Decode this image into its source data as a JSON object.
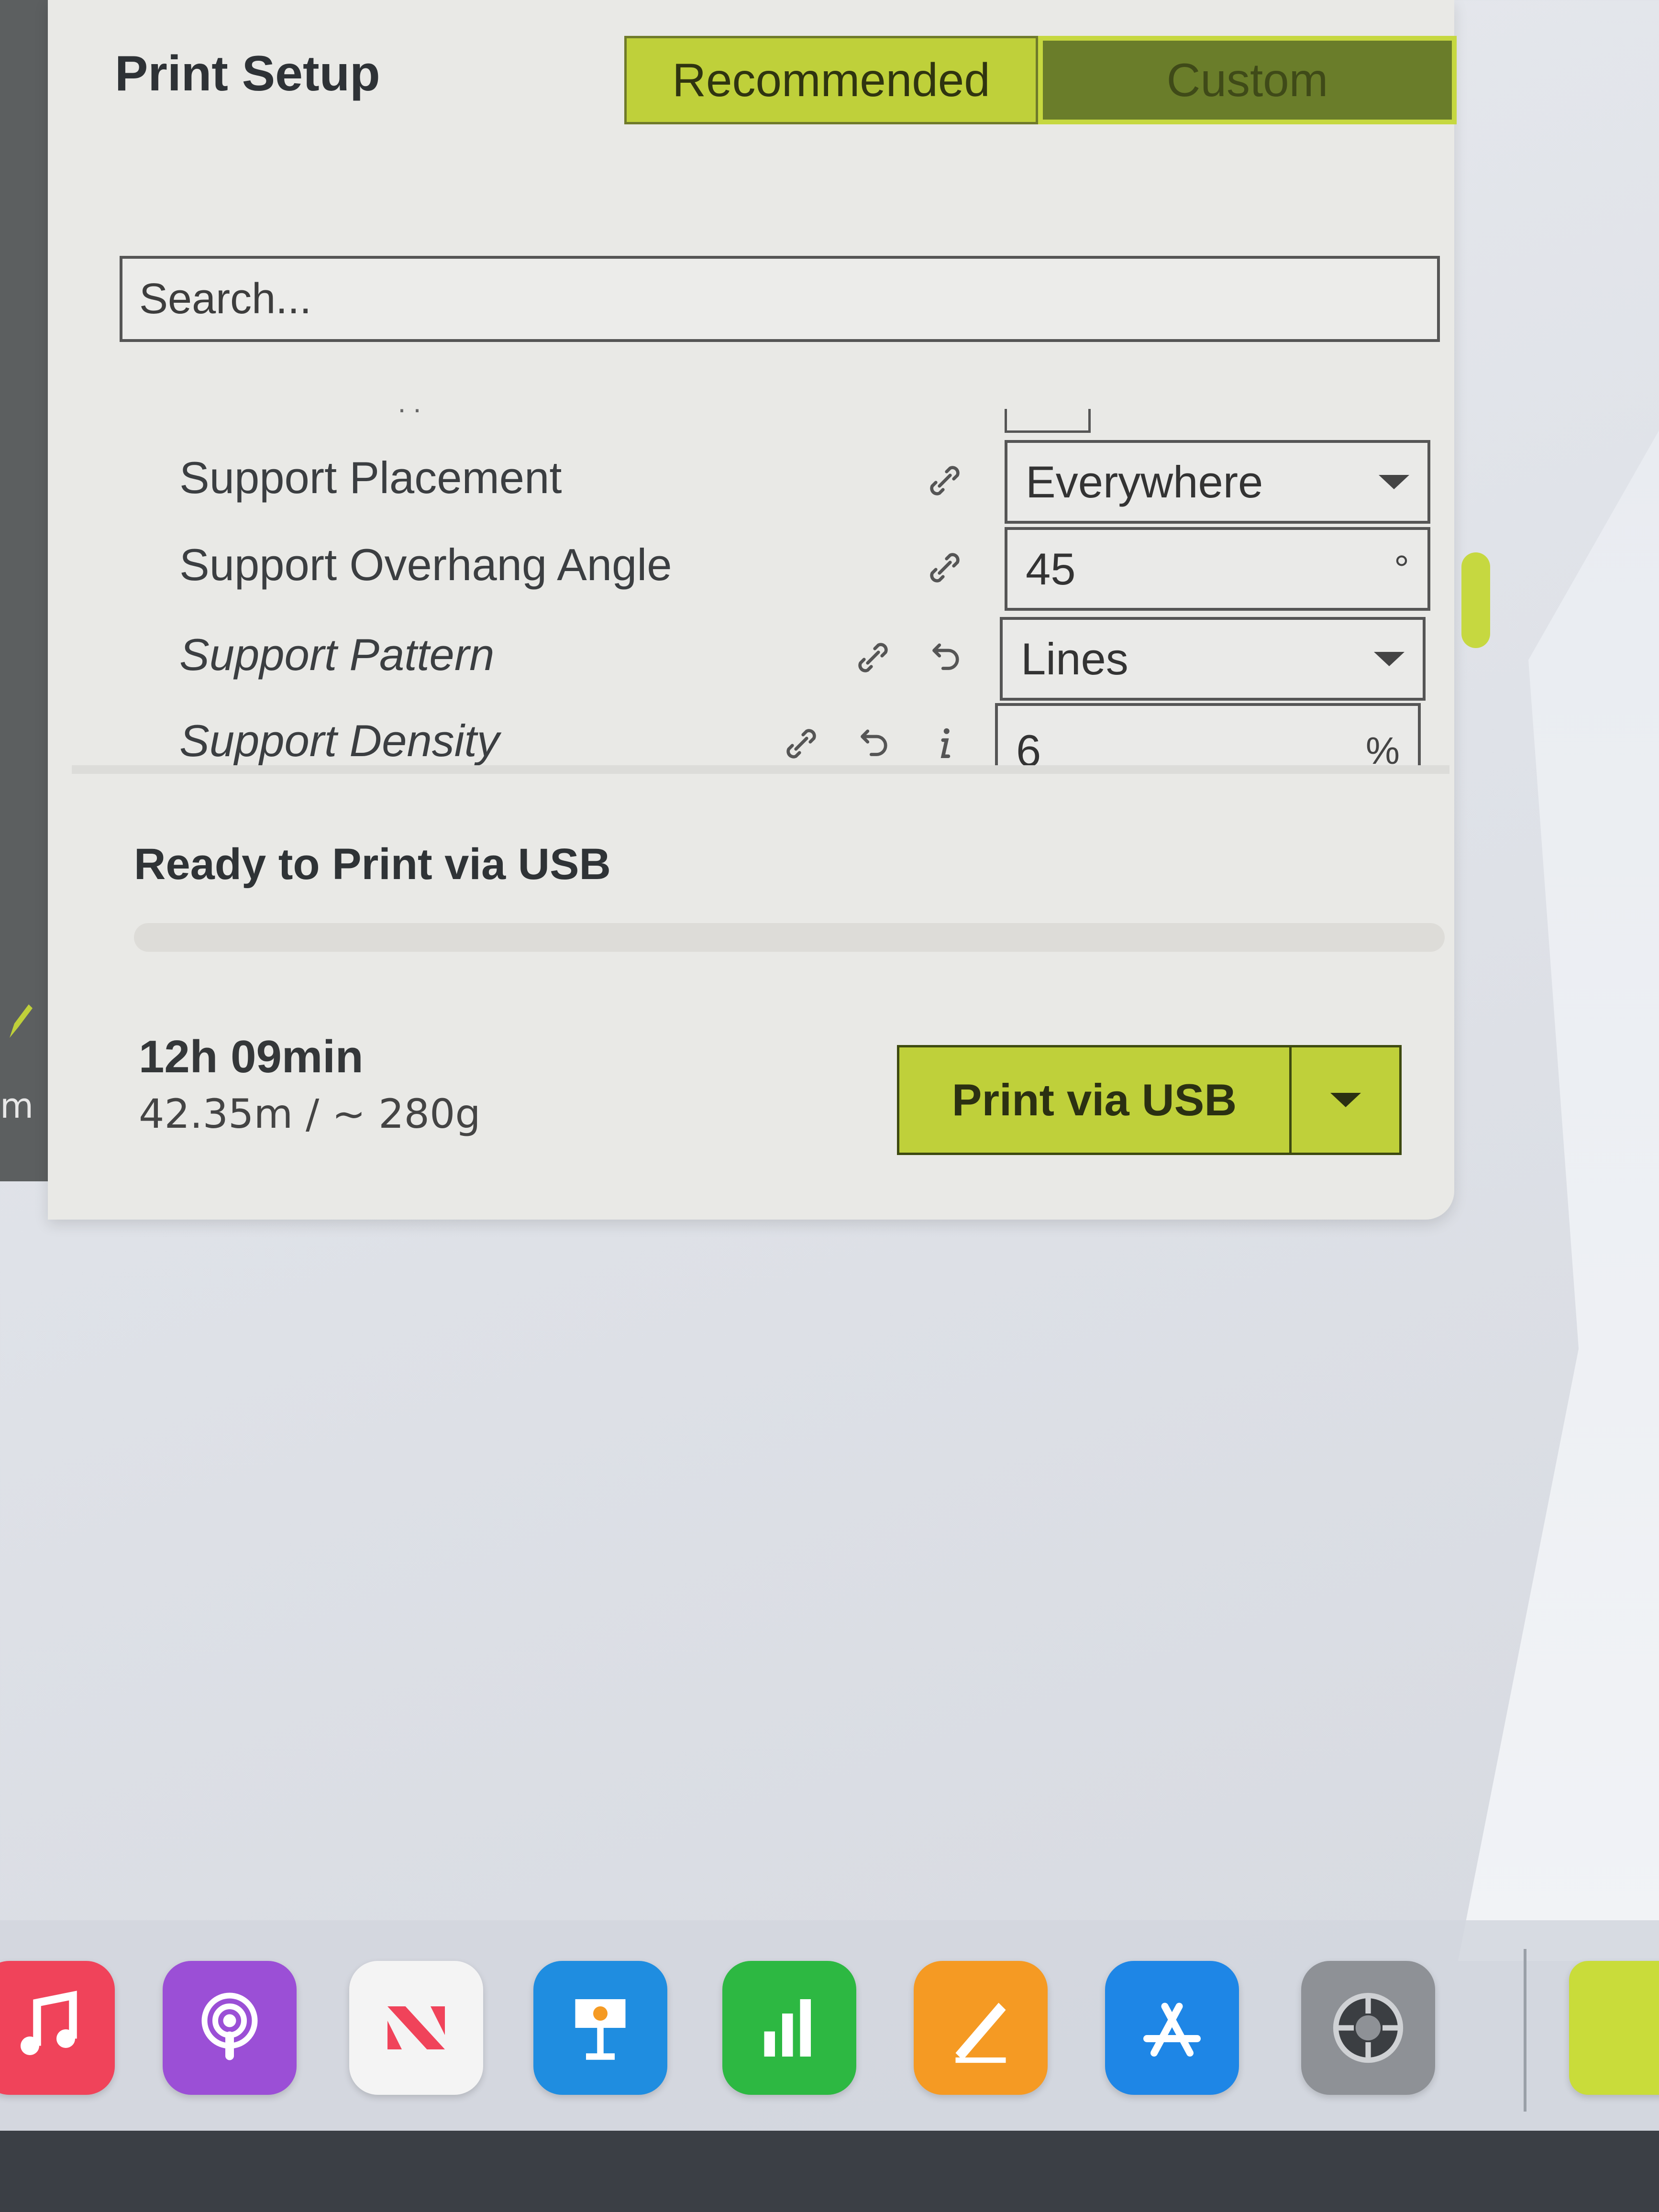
{
  "left_app": {
    "unit_fragment": "m"
  },
  "print_setup": {
    "title": "Print Setup",
    "tabs": [
      {
        "label": "Recommended"
      },
      {
        "label": "Custom"
      }
    ],
    "search": {
      "placeholder": "Search..."
    },
    "settings": [
      {
        "label": "Support Placement",
        "value": "Everywhere",
        "control": "dropdown",
        "icons": [
          "link-icon"
        ]
      },
      {
        "label": "Support Overhang Angle",
        "value": "45",
        "unit": "°",
        "control": "number",
        "icons": [
          "link-icon"
        ]
      },
      {
        "label": "Support Pattern",
        "value": "Lines",
        "control": "dropdown",
        "icons": [
          "link-icon",
          "reset-icon"
        ]
      },
      {
        "label": "Support Density",
        "value": "6",
        "unit": "%",
        "control": "number",
        "icons": [
          "link-icon",
          "reset-icon",
          "info-icon"
        ]
      }
    ],
    "accent_color": "#bfd03a",
    "dark_accent_color": "#6a7d2a"
  },
  "status": {
    "message": "Ready to Print via USB",
    "print_time": "12h 09min",
    "material": "42.35m / ~ 280g",
    "print_button": "Print via USB"
  },
  "dock": {
    "apps": [
      {
        "name": "Music",
        "icon": "music-icon",
        "color": "#f0435a"
      },
      {
        "name": "Podcasts",
        "icon": "podcasts-icon",
        "color": "#9b4fd6"
      },
      {
        "name": "News",
        "icon": "news-icon",
        "color": "#f4f4f4"
      },
      {
        "name": "Keynote",
        "icon": "keynote-icon",
        "color": "#1f8de0"
      },
      {
        "name": "Numbers",
        "icon": "numbers-icon",
        "color": "#2db842"
      },
      {
        "name": "Pages",
        "icon": "pages-icon",
        "color": "#f59a23"
      },
      {
        "name": "App Store",
        "icon": "app-store-icon",
        "color": "#1e86e6"
      },
      {
        "name": "System Settings",
        "icon": "settings-gear-icon",
        "color": "#8e9196"
      }
    ]
  }
}
